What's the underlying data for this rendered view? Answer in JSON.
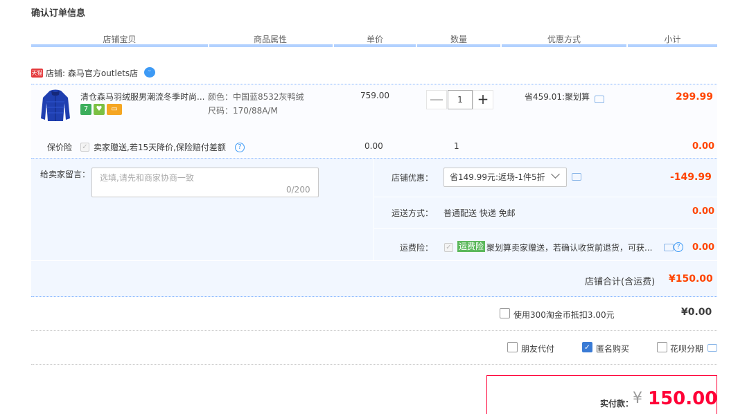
{
  "page": {
    "title": "确认订单信息"
  },
  "columns": [
    "店铺宝贝",
    "商品属性",
    "单价",
    "数量",
    "优惠方式",
    "小计"
  ],
  "shop": {
    "tag": "天猫",
    "name": "店铺: 森马官方outlets店"
  },
  "item": {
    "title": "清仓森马羽绒服男潮流冬季时尚...",
    "badges": [
      "7",
      "♥",
      "▭"
    ],
    "color": "颜色：中国蓝8532灰鸭绒",
    "size": "尺码：170/88A/M",
    "unit_price": "759.00",
    "quantity": "1",
    "minus": "—",
    "plus": "+",
    "promo": "省459.01:聚划算",
    "subtotal": "299.99"
  },
  "insurance": {
    "label": "保价险",
    "desc": "卖家赠送,若15天降价,保险赔付差额",
    "price": "0.00",
    "qty": "1",
    "subtotal": "0.00"
  },
  "message": {
    "label": "给卖家留言：",
    "placeholder": "选填,请先和商家协商一致",
    "count": "0/200"
  },
  "shop_discount": {
    "label": "店铺优惠：",
    "selected": "省149.99元:返场-1件5折",
    "amount": "-149.99"
  },
  "shipping": {
    "label": "运送方式：",
    "value": "普通配送 快递 免邮",
    "amount": "0.00"
  },
  "freight_ins": {
    "label": "运费险：",
    "tag": "运费险",
    "desc": "聚划算卖家赠送，若确认收货前退货，可获...",
    "amount": "0.00"
  },
  "shop_total": {
    "label": "店铺合计(含运费)",
    "value": "¥150.00"
  },
  "coins": {
    "label": "使用300淘金币抵扣3.00元",
    "value": "¥0.00"
  },
  "options": {
    "friend_pay": "朋友代付",
    "anonymous": "匿名购买",
    "huabei": "花呗分期"
  },
  "payment": {
    "label": "实付款：",
    "currency": "¥",
    "amount": "150.00"
  },
  "colors": {
    "accent_red": "#ff0036",
    "blue_line": "#b2d1ff",
    "panel_bg": "#f2f7ff"
  }
}
